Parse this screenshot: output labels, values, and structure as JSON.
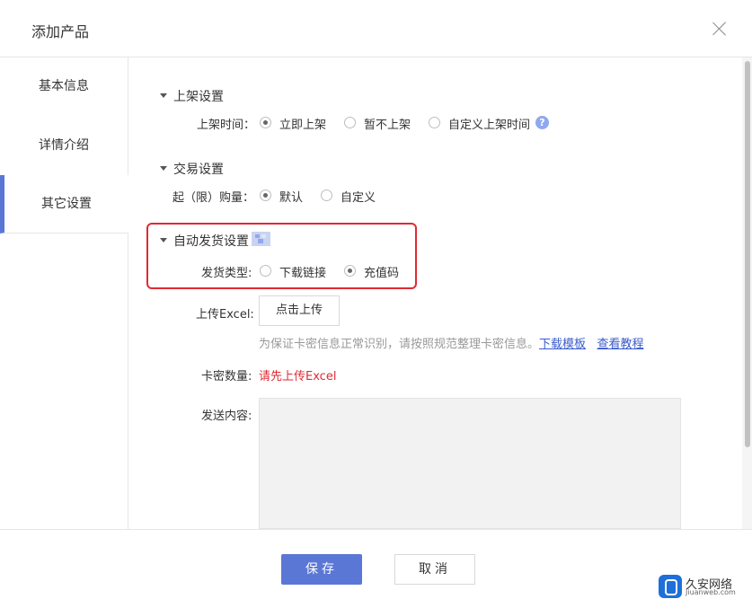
{
  "dialog": {
    "title": "添加产品"
  },
  "sidebar": {
    "items": [
      {
        "label": "基本信息"
      },
      {
        "label": "详情介绍"
      },
      {
        "label": "其它设置"
      }
    ]
  },
  "shelf": {
    "heading": "上架设置",
    "label": "上架时间：",
    "options": [
      "立即上架",
      "暂不上架",
      "自定义上架时间"
    ],
    "selected": "立即上架"
  },
  "trade": {
    "heading": "交易设置",
    "label": "起（限）购量：",
    "options": [
      "默认",
      "自定义"
    ],
    "selected": "默认"
  },
  "auto": {
    "heading": "自动发货设置",
    "label": "发货类型:",
    "options": [
      "下载链接",
      "充值码"
    ],
    "selected": "充值码"
  },
  "upload": {
    "label": "上传Excel:",
    "button": "点击上传",
    "hint": "为保证卡密信息正常识别，请按照规范整理卡密信息。",
    "link1": "下载模板",
    "link2": "查看教程"
  },
  "card": {
    "label": "卡密数量:",
    "value": "请先上传Excel"
  },
  "content": {
    "label": "发送内容:"
  },
  "footer": {
    "save": "保存",
    "cancel": "取消"
  },
  "watermark": {
    "name": "久安网络",
    "site": "Jiuanweb.com"
  },
  "colors": {
    "accent": "#5b77d6",
    "highlight": "#e02a33",
    "link": "#3b5bcc"
  }
}
